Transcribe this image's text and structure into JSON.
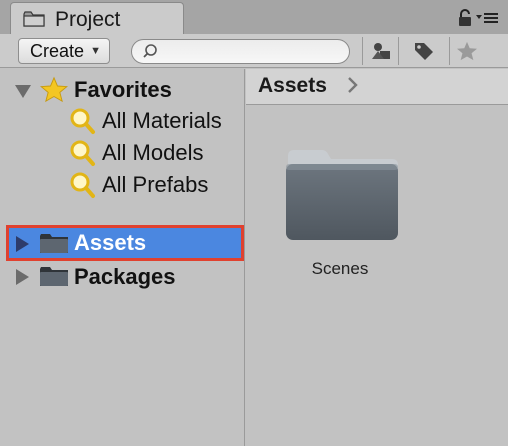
{
  "tab": {
    "title": "Project",
    "lock_icon": "lock-icon",
    "menu_icon": "panel-menu-icon"
  },
  "toolbar": {
    "create_label": "Create",
    "search_placeholder": "",
    "icons": [
      "filter-by-type-icon",
      "filter-by-label-icon",
      "favorite-star-icon"
    ]
  },
  "tree": {
    "favorites": {
      "label": "Favorites",
      "items": [
        {
          "label": "All Materials"
        },
        {
          "label": "All Models"
        },
        {
          "label": "All Prefabs"
        }
      ]
    },
    "roots": [
      {
        "label": "Assets",
        "selected": true
      },
      {
        "label": "Packages",
        "selected": false
      }
    ]
  },
  "breadcrumb": {
    "path": "Assets"
  },
  "assets": [
    {
      "label": "Scenes",
      "type": "folder"
    }
  ],
  "colors": {
    "selection": "#4b87e0",
    "highlight_box": "#e0412f",
    "panel_bg": "#c2c2c2"
  }
}
